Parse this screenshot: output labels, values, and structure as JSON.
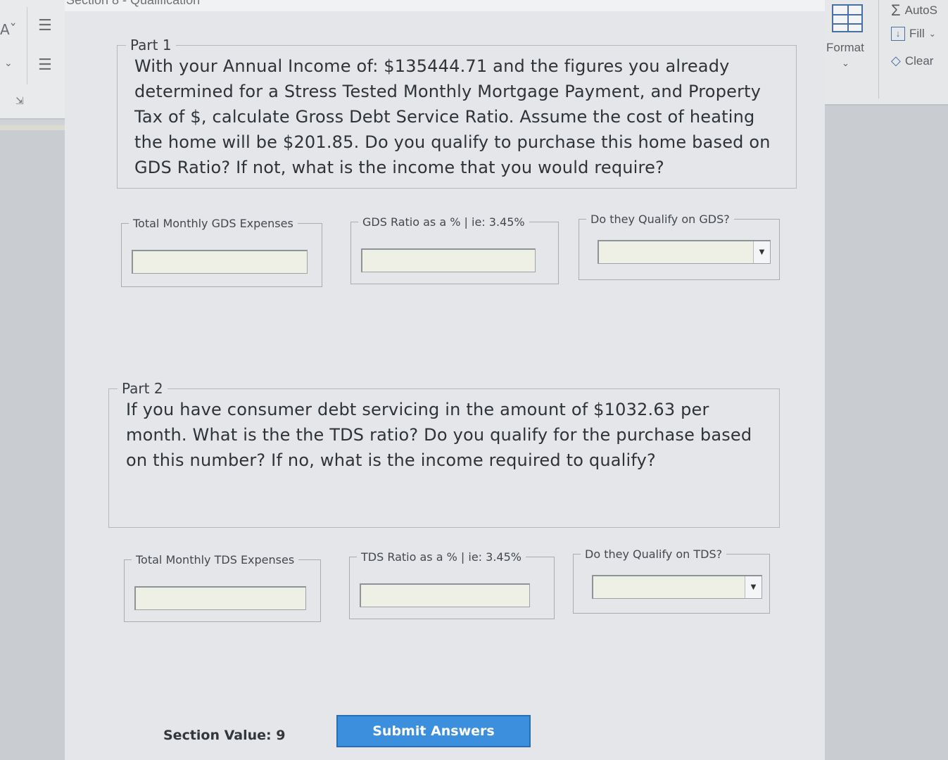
{
  "form_title": "Section 8 - Qualification",
  "ribbon": {
    "font_size_glyph": "Aˇ",
    "format_label": "Format",
    "autosum_label": "AutoS",
    "fill_label": "Fill",
    "clear_label": "Clear"
  },
  "part1": {
    "legend": "Part 1",
    "question": "With your Annual Income of: $135444.71 and the figures you already determined for a Stress Tested Monthly Mortgage Payment, and Property Tax of $, calculate Gross Debt Service Ratio. Assume the cost of heating the home will be $201.85. Do you qualify to purchase this home based on GDS Ratio? If not, what is the income that you would require?",
    "fields": {
      "expenses_label": "Total Monthly GDS Expenses",
      "expenses_value": "",
      "ratio_label": "GDS Ratio as a % | ie: 3.45%",
      "ratio_value": "",
      "qualify_label": "Do they Qualify on GDS?",
      "qualify_value": ""
    }
  },
  "part2": {
    "legend": "Part 2",
    "question": "If you have consumer debt servicing in the amount of $1032.63 per month. What is the the TDS ratio? Do you qualify for the purchase based on this number? If no, what is the income required to qualify?",
    "fields": {
      "expenses_label": "Total Monthly TDS Expenses",
      "expenses_value": "",
      "ratio_label": "TDS Ratio as a % | ie: 3.45%",
      "ratio_value": "",
      "qualify_label": "Do they Qualify on TDS?",
      "qualify_value": ""
    }
  },
  "footer": {
    "section_value": "Section Value: 9",
    "submit_label": "Submit Answers"
  }
}
